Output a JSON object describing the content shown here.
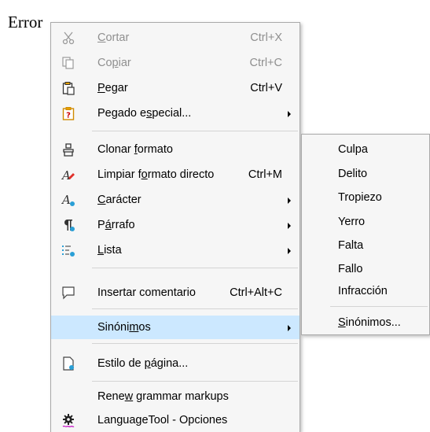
{
  "document": {
    "word": "Error"
  },
  "menu": {
    "items": [
      {
        "pre": "",
        "key": "C",
        "post": "ortar",
        "shortcut": "Ctrl+X",
        "icon": "scissors-icon"
      },
      {
        "pre": "Co",
        "key": "p",
        "post": "iar",
        "shortcut": "Ctrl+C",
        "icon": "copy-icon"
      },
      {
        "pre": "",
        "key": "P",
        "post": "egar",
        "shortcut": "Ctrl+V",
        "icon": "paste-icon"
      },
      {
        "pre": "Pegado e",
        "key": "s",
        "post": "pecial...",
        "icon": "paste-special-icon"
      },
      {
        "pre": "Clonar ",
        "key": "f",
        "post": "ormato",
        "icon": "clone-formatting-icon"
      },
      {
        "pre": "Limpiar f",
        "key": "o",
        "post": "rmato directo",
        "shortcut": "Ctrl+M",
        "icon": "clear-formatting-icon"
      },
      {
        "pre": "",
        "key": "C",
        "post": "arácter",
        "icon": "character-icon"
      },
      {
        "pre": "P",
        "key": "á",
        "post": "rrafo",
        "icon": "paragraph-icon"
      },
      {
        "pre": "",
        "key": "L",
        "post": "ista",
        "icon": "list-icon"
      },
      {
        "pre": "Insertar comentario",
        "key": "",
        "post": "",
        "shortcut": "Ctrl+Alt+C",
        "icon": "comment-icon"
      },
      {
        "pre": "Sinóni",
        "key": "m",
        "post": "os"
      },
      {
        "pre": "Estilo de ",
        "key": "p",
        "post": "ágina...",
        "icon": "page-style-icon"
      },
      {
        "pre": "Rene",
        "key": "w",
        "post": " grammar markups"
      },
      {
        "pre": "LanguageTool - Opciones",
        "key": "",
        "post": "",
        "icon": "languagetool-gear-icon"
      }
    ]
  },
  "submenu": {
    "items": [
      "Culpa",
      "Delito",
      "Tropiezo",
      "Yerro",
      "Falta",
      "Fallo",
      "Infracción"
    ],
    "more": {
      "pre": "",
      "key": "S",
      "post": "inónimos..."
    }
  },
  "colors": {
    "highlight": "#cce8ff",
    "menu_bg": "#f6f6f6",
    "disabled": "#8f8f8f"
  }
}
